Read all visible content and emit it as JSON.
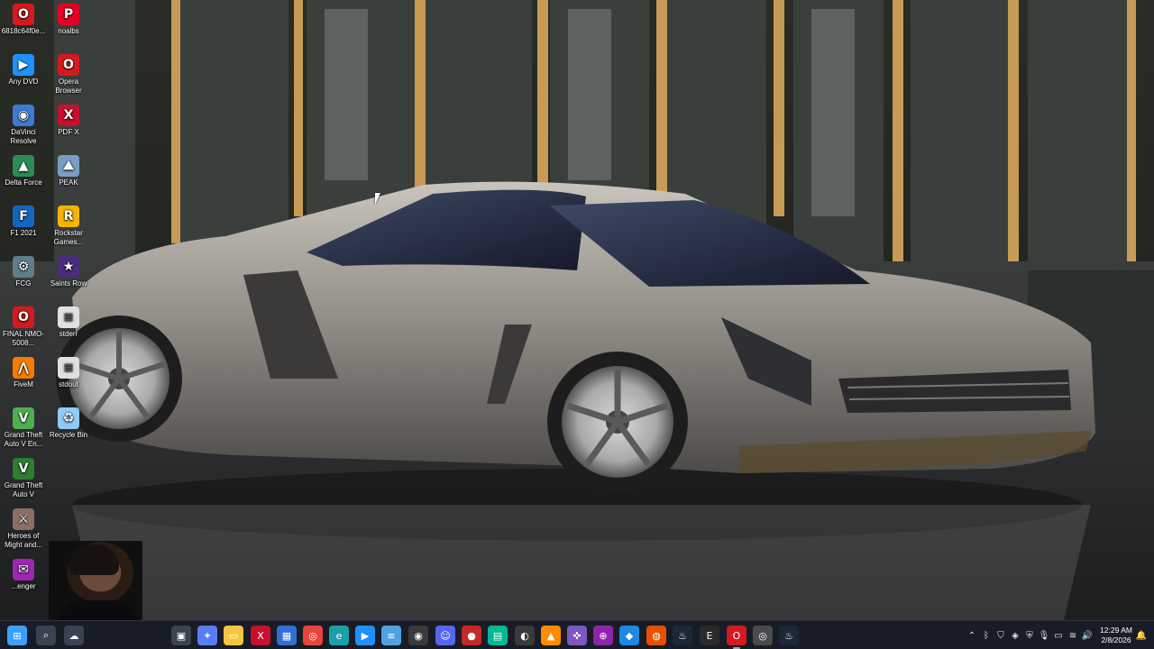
{
  "desktop_icons": [
    {
      "label": "6818c64f0e...",
      "icon": "opera-red-icon",
      "color": "#d41a1f",
      "glyph": "O"
    },
    {
      "label": "noalbs",
      "icon": "pinterest-icon",
      "color": "#e60023",
      "glyph": "P"
    },
    {
      "label": "Any DVD",
      "icon": "anydvd-play-icon",
      "color": "#1e90ff",
      "glyph": "▶"
    },
    {
      "label": "Opera Browser",
      "icon": "opera-browser-icon",
      "color": "#d41a1f",
      "glyph": "O"
    },
    {
      "label": "DaVinci Resolve",
      "icon": "davinci-resolve-icon",
      "color": "#3a7bd5",
      "glyph": "◉"
    },
    {
      "label": "PDF X",
      "icon": "pdf-x-icon",
      "color": "#c8102e",
      "glyph": "X"
    },
    {
      "label": "Delta Force",
      "icon": "delta-force-icon",
      "color": "#2e8b57",
      "glyph": "▲"
    },
    {
      "label": "PEAK",
      "icon": "peak-game-icon",
      "color": "#7a9cc6",
      "glyph": "⛰"
    },
    {
      "label": "F1 2021",
      "icon": "f1-2021-icon",
      "color": "#1565c0",
      "glyph": "F"
    },
    {
      "label": "Rockstar Games...",
      "icon": "rockstar-games-icon",
      "color": "#f4b400",
      "glyph": "R"
    },
    {
      "label": "FCG",
      "icon": "fcg-icon",
      "color": "#607d8b",
      "glyph": "⚙"
    },
    {
      "label": "Saints Row",
      "icon": "saints-row-icon",
      "color": "#4b2c7a",
      "glyph": "★"
    },
    {
      "label": "FINAL NMO-5008...",
      "icon": "opera-file-icon",
      "color": "#d41a1f",
      "glyph": "O"
    },
    {
      "label": "stderr",
      "icon": "text-file-icon",
      "color": "#e0e0e0",
      "glyph": "≡"
    },
    {
      "label": "FiveM",
      "icon": "fivem-icon",
      "color": "#f57c00",
      "glyph": "⋀"
    },
    {
      "label": "stdout",
      "icon": "text-file-icon",
      "color": "#e0e0e0",
      "glyph": "≡"
    },
    {
      "label": "Grand Theft Auto V En...",
      "icon": "gta-v-enhanced-icon",
      "color": "#4caf50",
      "glyph": "V"
    },
    {
      "label": "Recycle Bin",
      "icon": "recycle-bin-icon",
      "color": "#90caf9",
      "glyph": "♻"
    },
    {
      "label": "Grand Theft Auto V",
      "icon": "gta-v-icon",
      "color": "#2e7d32",
      "glyph": "V"
    },
    {
      "label": "Heroes of Might and...",
      "icon": "heroes-might-magic-icon",
      "color": "#8d6e63",
      "glyph": "⚔"
    },
    {
      "label": "...enger",
      "icon": "messenger-icon",
      "color": "#9c27b0",
      "glyph": "✉"
    }
  ],
  "taskbar": {
    "apps": [
      {
        "name": "start-button",
        "glyph": "⊞",
        "color": "#3aa0ff"
      },
      {
        "name": "search-icon",
        "glyph": "⌕",
        "color": "#3b4252"
      },
      {
        "name": "widgets-icon",
        "glyph": "☁",
        "color": "#3b4252"
      },
      {
        "name": "task-view-icon",
        "glyph": "▣",
        "color": "#3b4252"
      },
      {
        "name": "copilot-icon",
        "glyph": "✦",
        "color": "#5b7cfa"
      },
      {
        "name": "file-explorer-icon",
        "glyph": "▭",
        "color": "#f4c542"
      },
      {
        "name": "pdf-x-taskbar-icon",
        "glyph": "X",
        "color": "#c8102e"
      },
      {
        "name": "store-icon",
        "glyph": "▦",
        "color": "#2f6fd6"
      },
      {
        "name": "chrome-icon",
        "glyph": "◎",
        "color": "#e8453c"
      },
      {
        "name": "edge-icon",
        "glyph": "e",
        "color": "#1aa1a8"
      },
      {
        "name": "anydvd-taskbar-icon",
        "glyph": "▶",
        "color": "#1e90ff"
      },
      {
        "name": "notepad-icon",
        "glyph": "≡",
        "color": "#4fa3e0"
      },
      {
        "name": "davinci-taskbar-icon",
        "glyph": "◉",
        "color": "#3a3a3a"
      },
      {
        "name": "discord-icon",
        "glyph": "☺",
        "color": "#5865f2"
      },
      {
        "name": "video-record-icon",
        "glyph": "●",
        "color": "#c62828"
      },
      {
        "name": "terminal-icon",
        "glyph": "▤",
        "color": "#00b894"
      },
      {
        "name": "obs-icon",
        "glyph": "◐",
        "color": "#3a3a3a"
      },
      {
        "name": "vlc-icon",
        "glyph": "▲",
        "color": "#ff8c00"
      },
      {
        "name": "gamepad-icon",
        "glyph": "✜",
        "color": "#7e57c2"
      },
      {
        "name": "controller-icon",
        "glyph": "⊕",
        "color": "#8e24aa"
      },
      {
        "name": "app-blue-icon",
        "glyph": "◆",
        "color": "#1e88e5"
      },
      {
        "name": "origin-icon",
        "glyph": "◍",
        "color": "#e65100"
      },
      {
        "name": "steam-icon",
        "glyph": "♨",
        "color": "#1b2838"
      },
      {
        "name": "epic-games-icon",
        "glyph": "E",
        "color": "#2a2a2a"
      },
      {
        "name": "opera-taskbar-icon",
        "glyph": "O",
        "color": "#d41a1f"
      },
      {
        "name": "chrome-alt-icon",
        "glyph": "◎",
        "color": "#4a4a4a"
      },
      {
        "name": "steam-alt-icon",
        "glyph": "♨",
        "color": "#1b2838"
      }
    ],
    "tray": [
      {
        "name": "chevron-up-icon",
        "glyph": "⌃"
      },
      {
        "name": "bluetooth-icon",
        "glyph": "ᛒ"
      },
      {
        "name": "shield-icon",
        "glyph": "⛉"
      },
      {
        "name": "network-app-icon",
        "glyph": "◈"
      },
      {
        "name": "security-icon",
        "glyph": "⛨"
      },
      {
        "name": "microphone-icon",
        "glyph": "🎙"
      },
      {
        "name": "display-icon",
        "glyph": "▭"
      },
      {
        "name": "wifi-icon",
        "glyph": "≋"
      },
      {
        "name": "volume-icon",
        "glyph": "🔊"
      }
    ],
    "clock": {
      "time": "12:29 AM",
      "date": "2/8/2026"
    },
    "notification_glyph": "🔔"
  }
}
